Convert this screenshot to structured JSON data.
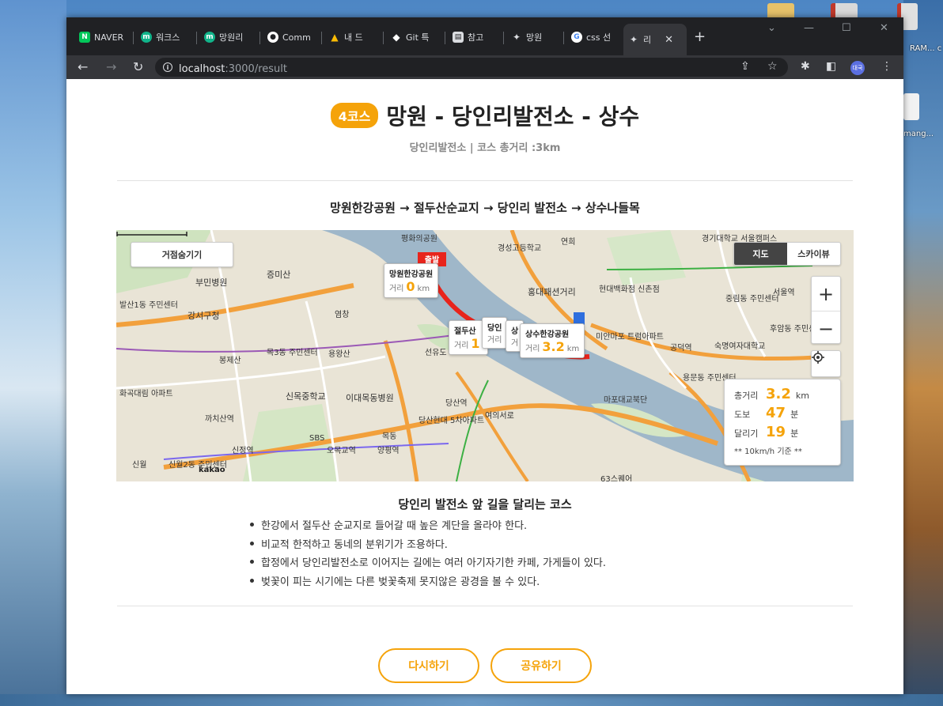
{
  "desktop": {
    "right_labels": [
      "RAM... c",
      "mang..."
    ]
  },
  "browser": {
    "tabs": [
      {
        "label": "NAVER",
        "icon": "naver-icon",
        "color": "#03c75a",
        "glyph": "N"
      },
      {
        "label": "워크스",
        "icon": "workspace-icon",
        "color": "#11b48a",
        "glyph": "m"
      },
      {
        "label": "망원리",
        "icon": "mangwon-icon",
        "color": "#11b48a",
        "glyph": "m"
      },
      {
        "label": "Comm",
        "icon": "github-icon",
        "color": "#ffffff",
        "glyph": "◯"
      },
      {
        "label": "내 드",
        "icon": "google-drive-icon",
        "color": "#fbbc04",
        "glyph": "▲"
      },
      {
        "label": "Git 특",
        "icon": "git-icon",
        "color": "#ffffff",
        "glyph": "◆"
      },
      {
        "label": "참고",
        "icon": "document-icon",
        "color": "#dadce0",
        "glyph": "▤"
      },
      {
        "label": "망원",
        "icon": "runner-icon",
        "color": "#dadce0",
        "glyph": "🏃"
      },
      {
        "label": "css 선",
        "icon": "google-icon",
        "color": "#ffffff",
        "glyph": "G"
      },
      {
        "label": "리",
        "icon": "runner-icon",
        "color": "#dadce0",
        "glyph": "🏃"
      }
    ],
    "active_tab_index": 9,
    "new_tab_label": "+",
    "url_host": "localhost",
    "url_path": ":3000/result",
    "profile_label": "대국"
  },
  "page": {
    "course_badge": "4코스",
    "title": "망원 - 당인리발전소 - 상수",
    "subtitle": "당인리발전소 | 코스 총거리 :3km",
    "route": "망원한강공원 → 절두산순교지 → 당인리 발전소 → 상수나들목",
    "map": {
      "hide_places_label": "거점숨기기",
      "type_map": "지도",
      "type_sky": "스카이뷰",
      "zoom_in": "+",
      "zoom_out": "−",
      "stats": {
        "total_label": "총거리",
        "total_value": "3.2",
        "total_unit": "km",
        "walk_label": "도보",
        "walk_value": "47",
        "walk_unit": "분",
        "run_label": "달리기",
        "run_value": "19",
        "run_unit": "분",
        "note": "** 10km/h 기준 **"
      },
      "infowindows": [
        {
          "name": "망원한강공원",
          "dist_label": "거리",
          "dist_value": "0",
          "dist_unit": "km"
        },
        {
          "name": "절두산",
          "dist_label": "거리",
          "dist_value": "1",
          "dist_unit": ""
        },
        {
          "name": "당인",
          "dist_label": "거리",
          "dist_value": "",
          "dist_unit": ""
        },
        {
          "name": "상",
          "dist_label": "거",
          "dist_value": "",
          "dist_unit": ""
        },
        {
          "name": "상수한강공원",
          "dist_label": "거리",
          "dist_value": "3.2",
          "dist_unit": "km"
        }
      ],
      "start_marker": "출발",
      "labels": [
        "평화의공원",
        "경성고등학교",
        "연희",
        "경기대학교 서울캠퍼스",
        "증미산",
        "부민병원",
        "발산1동 주민센터",
        "강서구청",
        "염창",
        "홍대패션거리",
        "현대백화점 신촌점",
        "중림동 주민센터",
        "서울역",
        "후암동 주민센터",
        "목3동 주민센터",
        "봉제산",
        "용왕산",
        "선유도",
        "숙명여자대학교",
        "공덕역",
        "미안마포 트럼아파트",
        "용문동 주민센터",
        "화곡대림 아파트",
        "신목중학교",
        "이대목동병원",
        "당산역",
        "당산현대 5차아파트",
        "여의서로",
        "마포대교북단",
        "까치산역",
        "SBS",
        "목동",
        "신월",
        "신월2동 주민센터",
        "63스퀘어",
        "양평역",
        "오목교역",
        "신정역"
      ],
      "attribution": "kakao"
    },
    "desc_title": "당인리 발전소 앞 길을 달리는 코스",
    "bullets": [
      "한강에서 절두산 순교지로 들어갈 때 높은 계단을 올라야 한다.",
      "비교적 한적하고 동네의 분위기가 조용하다.",
      "합정에서 당인리발전소로 이어지는 길에는 여러 아기자기한 카페, 가게들이 있다.",
      "벚꽃이 피는 시기에는 다른 벚꽃축제 못지않은 광경을 볼 수 있다."
    ],
    "buttons": {
      "retry": "다시하기",
      "share": "공유하기"
    },
    "colors": {
      "accent": "#f5a30a",
      "route": "#e8241c",
      "river": "#9fb7c9"
    }
  }
}
